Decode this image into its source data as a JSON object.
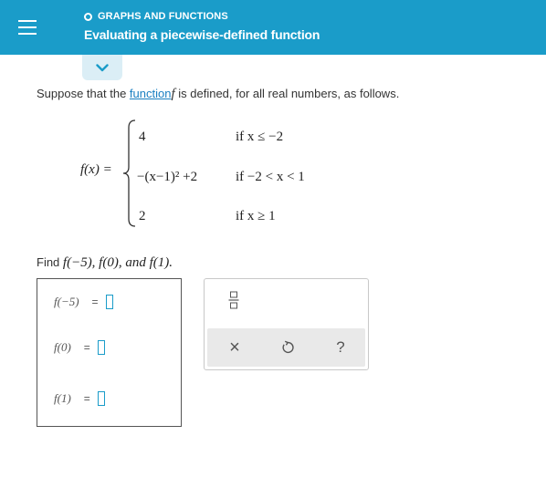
{
  "header": {
    "topic": "GRAPHS AND FUNCTIONS",
    "title": "Evaluating a piecewise-defined function"
  },
  "prompt": {
    "before": "Suppose that the ",
    "link": "function",
    "fvar": "f",
    "after": " is defined, for all real numbers, as follows."
  },
  "piecewise": {
    "lhs": "f(x) =",
    "cases": [
      {
        "expr": "4",
        "cond": "if x ≤ −2"
      },
      {
        "expr": "−(x−1)² +2",
        "cond": "if −2 < x < 1"
      },
      {
        "expr": "2",
        "cond": "if x ≥ 1"
      }
    ]
  },
  "find": {
    "prefix": "Find ",
    "items": "f(−5), f(0), and f(1)."
  },
  "answers": [
    {
      "label": "f(−5)",
      "eq": "="
    },
    {
      "label": "f(0)",
      "eq": "="
    },
    {
      "label": "f(1)",
      "eq": "="
    }
  ],
  "toolbar": {
    "clear_glyph": "×",
    "help_glyph": "?"
  },
  "colors": {
    "header_bg": "#1a9cc9",
    "link": "#1a7fc1",
    "input_border": "#1a9cc9",
    "toolbar_bg": "#e9e9e9"
  }
}
